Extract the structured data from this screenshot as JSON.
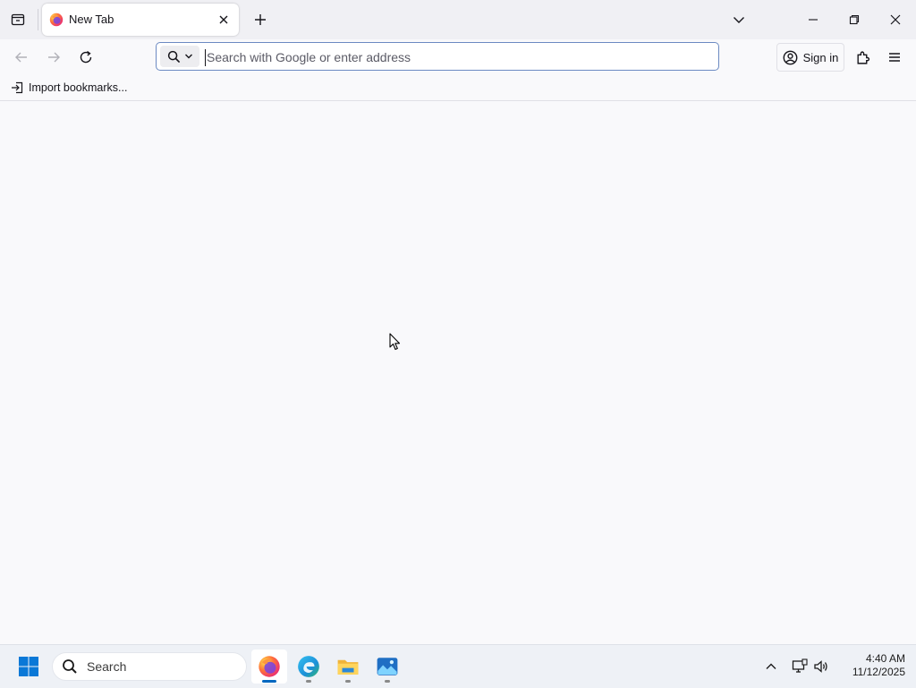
{
  "tab": {
    "title": "New Tab"
  },
  "urlbar": {
    "placeholder": "Search with Google or enter address",
    "value": ""
  },
  "toolbar": {
    "signin_label": "Sign in"
  },
  "bookmarks": {
    "import_label": "Import bookmarks..."
  },
  "taskbar": {
    "search_label": "Search",
    "apps": [
      {
        "name": "firefox",
        "icon": "firefox-icon"
      },
      {
        "name": "edge",
        "icon": "edge-icon"
      },
      {
        "name": "file-explorer",
        "icon": "folder-icon"
      },
      {
        "name": "photos",
        "icon": "photos-icon"
      }
    ]
  },
  "clock": {
    "time": "4:40 AM",
    "date": "11/12/2025"
  },
  "colors": {
    "accent": "#0061e0",
    "tab_strip": "#f0f0f4",
    "urlbar_focus": "#6c8ac2",
    "taskbar": "#eef1f6"
  }
}
